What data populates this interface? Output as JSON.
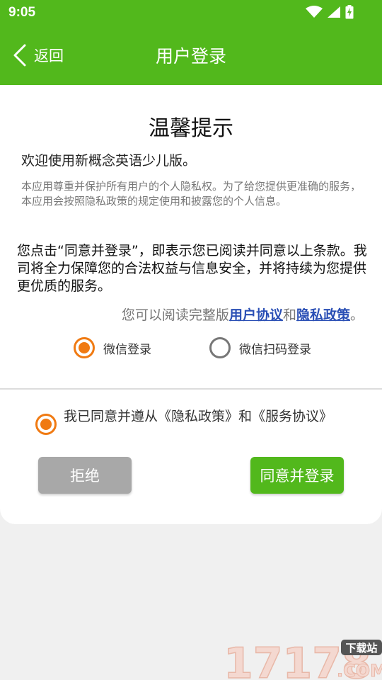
{
  "status_bar": {
    "time": "9:05"
  },
  "nav": {
    "back_label": "返回",
    "title": "用户登录"
  },
  "dialog": {
    "title": "温馨提示",
    "welcome": "欢迎使用新概念英语少儿版。",
    "notice": "本应用尊重并保护所有用户的个人隐私权。为了给您提供更准确的服务，本应用会按照隐私政策的规定使用和披露您的个人信息。",
    "terms": "您点击“同意并登录”，即表示您已阅读并同意以上条款。我司将全力保障您的合法权益与信息安全，并将持续为您提供更优质的服务。",
    "read_prefix": "您可以阅读完整版",
    "user_agreement_link": "用户协议",
    "and_text": "和",
    "privacy_link": "隐私政策",
    "period": "。"
  },
  "login_options": [
    {
      "label": "微信登录",
      "selected": true
    },
    {
      "label": "微信扫码登录",
      "selected": false
    }
  ],
  "agreement": {
    "text": "我已同意并遵从《隐私政策》和《服务协议》",
    "checked": true
  },
  "buttons": {
    "reject": "拒绝",
    "agree": "同意并登录"
  },
  "watermark": {
    "number": "17178",
    "badge": "下载站",
    "domain": ".COM"
  },
  "colors": {
    "primary_green": "#52b81c",
    "accent_orange": "#f07a12",
    "link_blue": "#2a4fb5",
    "reject_gray": "#a8a8a8"
  }
}
